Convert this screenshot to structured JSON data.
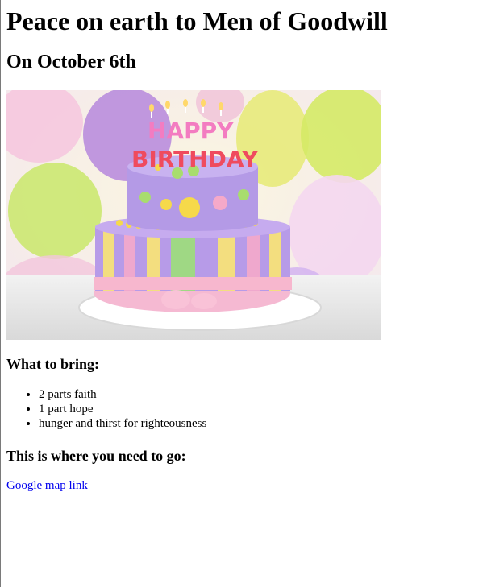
{
  "page": {
    "title": "Peace on earth to Men of Goodwill",
    "date_heading": "On October 6th",
    "image": {
      "description_icon": "birthday-cake-image",
      "topper_word_1": "HAPPY",
      "topper_word_2": "BIRTHDAY"
    },
    "bring_heading": "What to bring:",
    "bring_items": [
      "2 parts faith",
      "1 part hope",
      "hunger and thirst for righteousness"
    ],
    "go_heading": "This is where you need to go:",
    "map_link_label": "Google map link"
  },
  "colors": {
    "link": "#0000ee",
    "text": "#000000",
    "background": "#ffffff"
  }
}
